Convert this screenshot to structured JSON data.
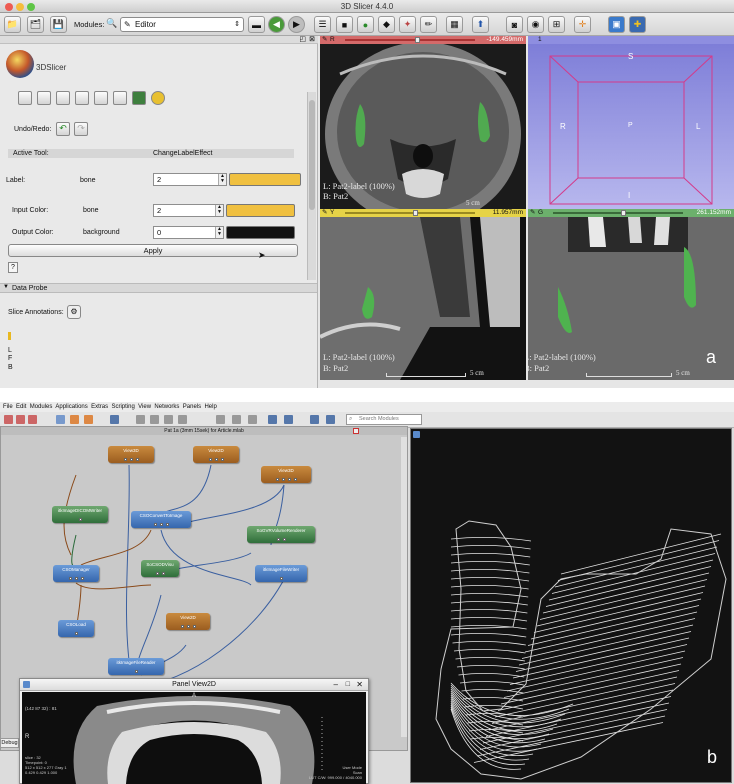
{
  "slicer": {
    "window_title": "3D Slicer 4.4.0",
    "toolbar": {
      "modules_label": "Modules:",
      "module_selected": "Editor"
    },
    "logo_text": "3DSlicer",
    "undo_redo_label": "Undo/Redo:",
    "active_tool_label": "Active Tool:",
    "active_tool_value": "ChangeLabelEffect",
    "label_row": {
      "label": "Label:",
      "name": "bone",
      "value": "2",
      "color": "#f0c040"
    },
    "input_color_row": {
      "label": "Input Color:",
      "name": "bone",
      "value": "2",
      "color": "#f0c040"
    },
    "output_color_row": {
      "label": "Output Color:",
      "name": "background",
      "value": "0",
      "color": "#111111"
    },
    "apply_button": "Apply",
    "help_button": "?",
    "data_probe_label": "Data Probe",
    "slice_annotations_label": "Slice Annotations:",
    "probe_letters": [
      "L",
      "F",
      "B"
    ],
    "views": {
      "red": {
        "letter": "R",
        "value": "-149.459mm",
        "overlay_l": "L: Pat2-label (100%)",
        "overlay_b": "B: Pat2"
      },
      "threed": {
        "letter": "1",
        "labels": {
          "s": "S",
          "r": "R",
          "p": "P",
          "l": "L",
          "i": "I"
        }
      },
      "yellow": {
        "letter": "Y",
        "value": "11.957mm"
      },
      "green": {
        "letter": "G",
        "value": "261.152mm",
        "overlay_l": "L: Pat2-label (100%)",
        "overlay_b": "B: Pat2",
        "scale": "5 cm"
      }
    },
    "yellow_overlay_l": "L: Pat2-label (100%)",
    "yellow_overlay_b": "B: Pat2",
    "yellow_scale": "5 cm",
    "red_scale": "5 cm",
    "panel_letter": "a"
  },
  "mevislab": {
    "menu": [
      "File",
      "Edit",
      "Modules",
      "Applications",
      "Extras",
      "Scripting",
      "View",
      "Networks",
      "Panels",
      "Help"
    ],
    "search_placeholder": "Search Modules",
    "network_title": "Pat 1a (3mm 15sek) for Article.mlab",
    "modules": [
      {
        "label": "View3D"
      },
      {
        "label": "View2D"
      },
      {
        "label": "View3D"
      },
      {
        "label": "itkImageDICOMWriter"
      },
      {
        "label": "CSOConvertToImage"
      },
      {
        "label": "SoGVRVolumeRenderer"
      },
      {
        "label": "CSOManager"
      },
      {
        "label": "SoCSODVisu"
      },
      {
        "label": "itkImageFileWriter"
      },
      {
        "label": "CSOLoad"
      },
      {
        "label": "View2D"
      },
      {
        "label": "itkImageFileReader"
      }
    ],
    "panel2d": {
      "title": "Panel View2D",
      "top_letter": "A",
      "left_letter": "R",
      "coords": "(142 87 32) : 81",
      "info_left": [
        "slice : 32",
        "Timepoint: 0",
        "512 x 512 x 277 Gray 1",
        "0.429 0.429 1.000"
      ],
      "info_right": [
        "User Mode",
        "Scan",
        "LUT C/W: 999.000 / 4040.000"
      ]
    },
    "debug_tab": "Debug",
    "panel_letter": "b"
  }
}
